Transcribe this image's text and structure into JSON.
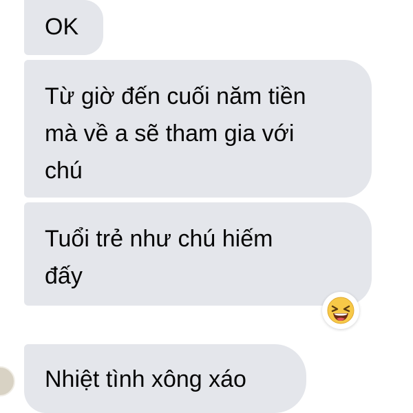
{
  "messages": [
    {
      "text": "OK"
    },
    {
      "text": "Từ giờ đến cuối năm tiền\nmà về a sẽ tham gia với\nchú"
    },
    {
      "text": "Tuổi trẻ như chú hiếm\nđấy"
    },
    {
      "text": "Nhiệt tình xông xáo"
    }
  ],
  "reaction": {
    "icon": "laughing-emoji-icon"
  },
  "colors": {
    "bubble": "#e4e6eb",
    "text": "#050505",
    "emoji": "#f7c948"
  }
}
